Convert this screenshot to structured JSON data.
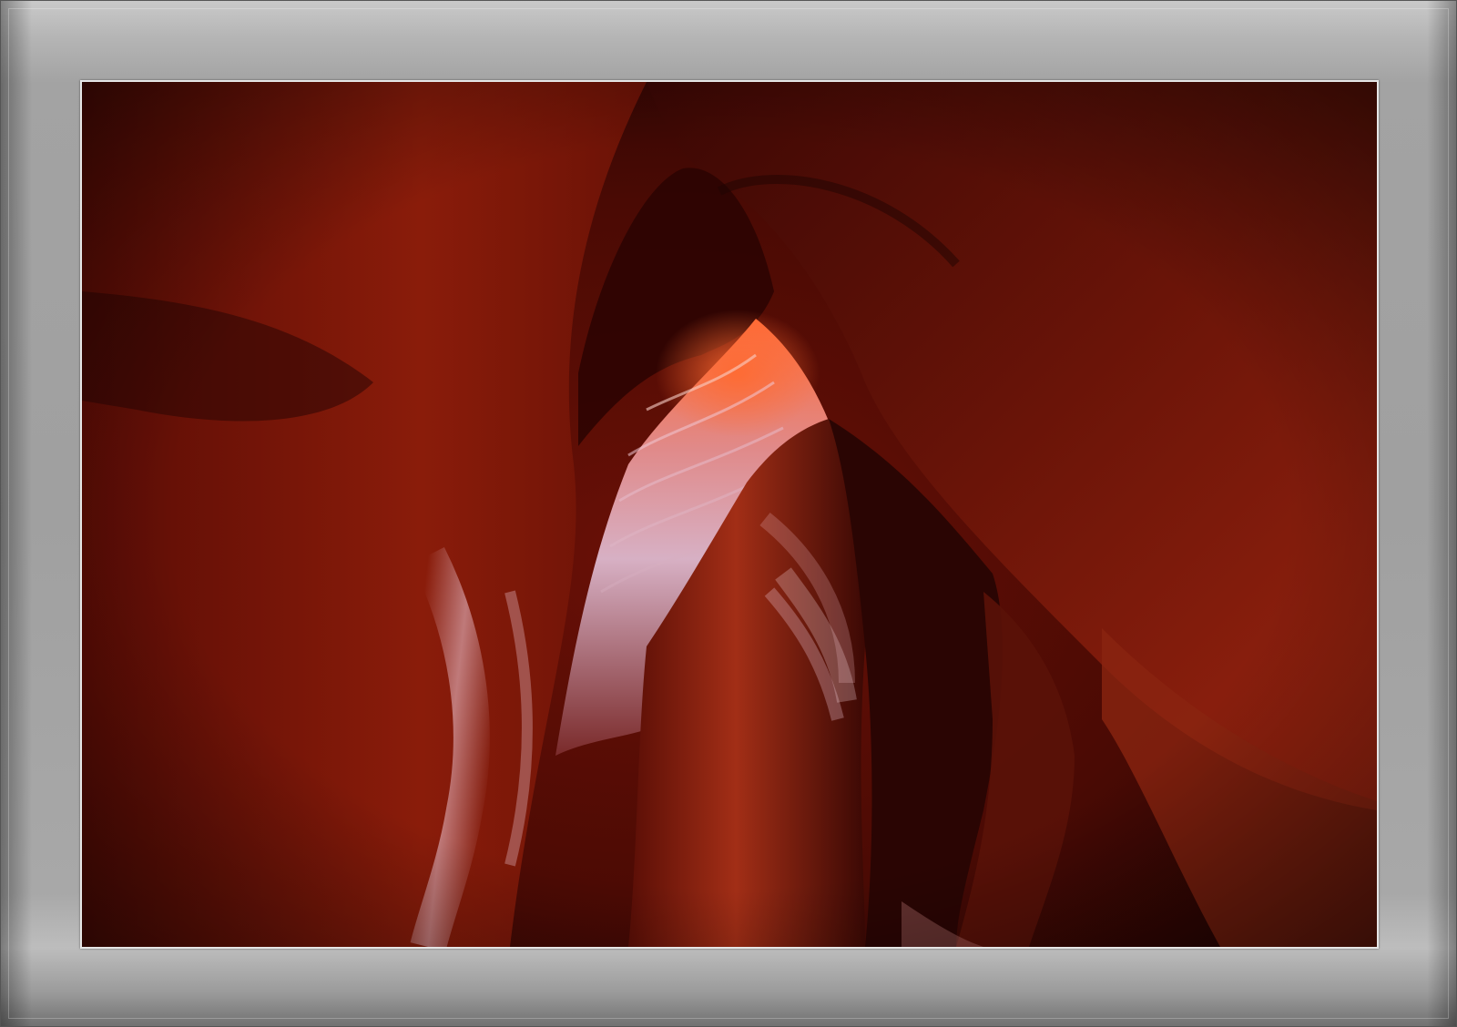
{
  "frame": {
    "border_color": "#a8a8a8",
    "mat_color": "#e6e6e6"
  },
  "photo": {
    "colors": {
      "deep": "#1a0202",
      "shadow": "#3a0704",
      "mid": "#6e1408",
      "warm": "#9e2a12",
      "glow": "#e0522a",
      "highlight": "#e9c3cf"
    }
  }
}
